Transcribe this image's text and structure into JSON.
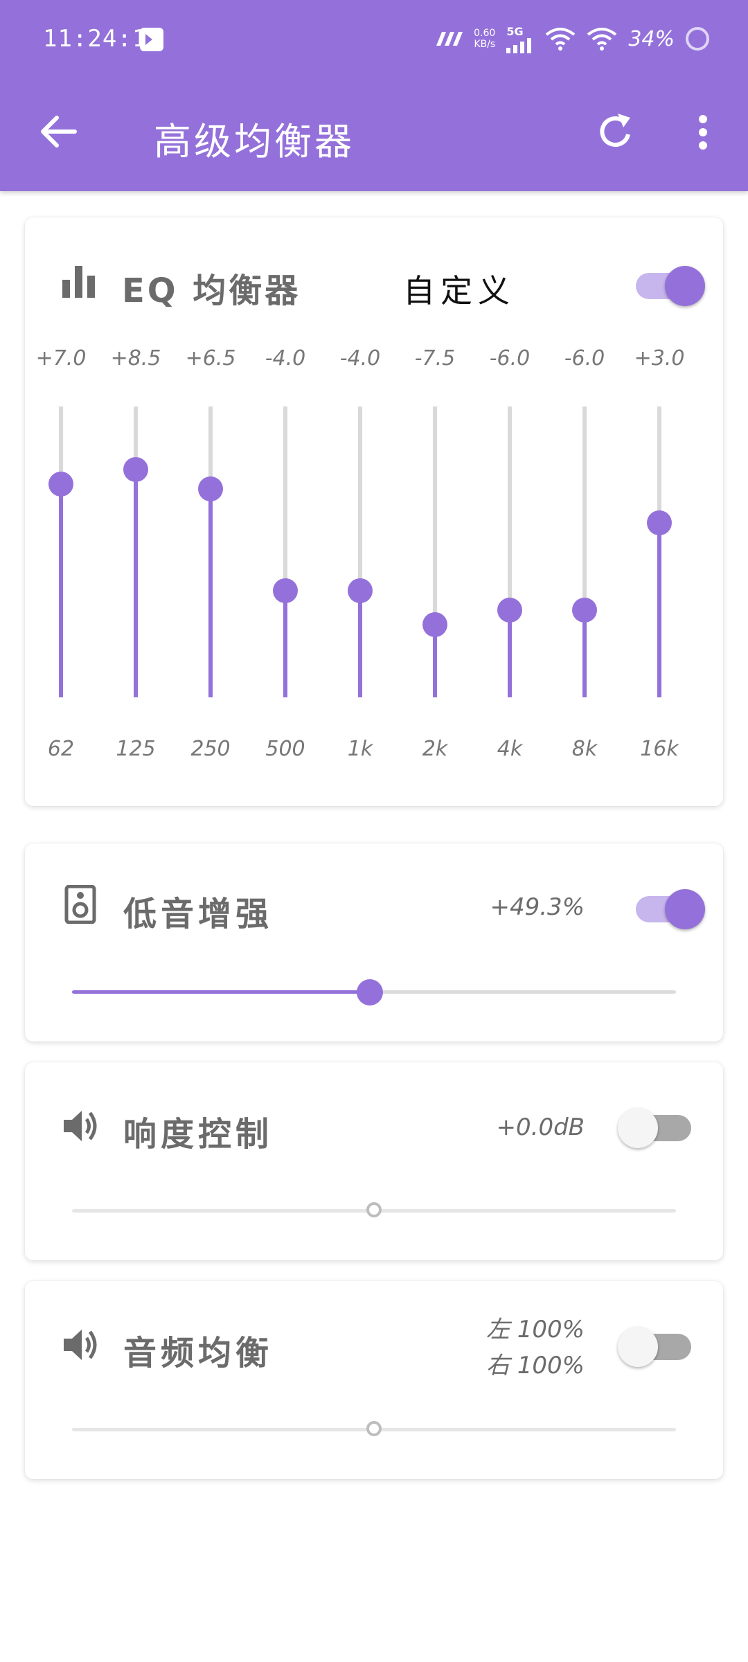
{
  "status_bar": {
    "time": "11:24:15",
    "speed_value": "0.60",
    "speed_unit": "KB/s",
    "network": "5G",
    "battery": "34%"
  },
  "app_bar": {
    "title": "高级均衡器"
  },
  "eq": {
    "title": "EQ 均衡器",
    "preset": "自定义",
    "enabled": true,
    "gain_range": [
      -15,
      15
    ],
    "bands": [
      {
        "freq": "62",
        "gain_label": "+7.0",
        "gain": 7.0
      },
      {
        "freq": "125",
        "gain_label": "+8.5",
        "gain": 8.5
      },
      {
        "freq": "250",
        "gain_label": "+6.5",
        "gain": 6.5
      },
      {
        "freq": "500",
        "gain_label": "-4.0",
        "gain": -4.0
      },
      {
        "freq": "1k",
        "gain_label": "-4.0",
        "gain": -4.0
      },
      {
        "freq": "2k",
        "gain_label": "-7.5",
        "gain": -7.5
      },
      {
        "freq": "4k",
        "gain_label": "-6.0",
        "gain": -6.0
      },
      {
        "freq": "8k",
        "gain_label": "-6.0",
        "gain": -6.0
      },
      {
        "freq": "16k",
        "gain_label": "+3.0",
        "gain": 3.0
      }
    ]
  },
  "bass": {
    "title": "低音增强",
    "value": "+49.3%",
    "enabled": true,
    "level": 0.493
  },
  "loudness": {
    "title": "响度控制",
    "value": "+0.0dB",
    "enabled": false,
    "level": 0.5
  },
  "balance": {
    "title": "音频均衡",
    "left": "左 100%",
    "right": "右 100%",
    "enabled": false,
    "level": 0.5
  },
  "colors": {
    "accent": "#9471da",
    "accent_light": "#c7b5ed",
    "track": "#d9d9d9"
  }
}
